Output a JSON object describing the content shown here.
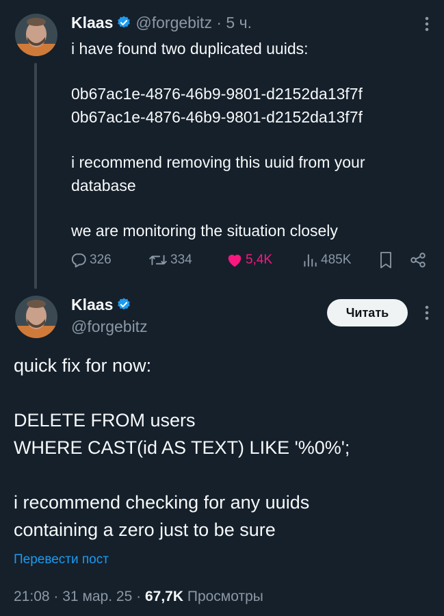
{
  "tweet1": {
    "name": "Klaas",
    "handle": "@forgebitz",
    "separator": "·",
    "time": "5 ч.",
    "lines": [
      "i have found two duplicated uuids:",
      "0b67ac1e-4876-46b9-9801-d2152da13f7f",
      "0b67ac1e-4876-46b9-9801-d2152da13f7f",
      "i recommend removing this uuid from your",
      "database",
      "we are monitoring the situation closely"
    ],
    "stats": {
      "replies": "326",
      "retweets": "334",
      "likes": "5,4K",
      "views": "485K"
    }
  },
  "tweet2": {
    "name": "Klaas",
    "handle": "@forgebitz",
    "follow_label": "Читать",
    "lines": [
      "quick fix for now:",
      "DELETE FROM users",
      "WHERE CAST(id AS TEXT) LIKE '%0%';",
      "i recommend checking for any uuids",
      "containing a zero just to be sure"
    ],
    "translate_label": "Перевести пост",
    "meta": {
      "time": "21:08",
      "sep1": "·",
      "date": "31 мар. 25",
      "sep2": "·",
      "views_count": "67,7K",
      "views_label": "Просмотры"
    }
  },
  "colors": {
    "background": "#15202b",
    "text": "#f7f9f9",
    "muted": "#8b98a5",
    "like": "#f91880",
    "link": "#1d9bf0",
    "verified": "#1d9bf0"
  }
}
